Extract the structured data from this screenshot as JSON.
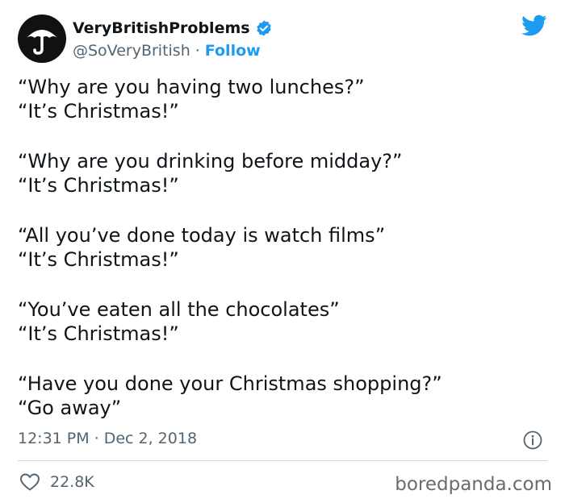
{
  "author": {
    "display_name": "VeryBritishProblems",
    "handle": "@SoVeryBritish",
    "separator": "·",
    "follow_label": "Follow",
    "avatar_icon": "umbrella-icon",
    "verified_icon": "verified-badge-icon"
  },
  "tweet": {
    "paragraphs": [
      {
        "line1": "“Why are you having two lunches?”",
        "line2": "“It’s Christmas!”"
      },
      {
        "line1": "“Why are you drinking before midday?”",
        "line2": "“It’s Christmas!”"
      },
      {
        "line1": "“All you’ve done today is watch films”",
        "line2": "“It’s Christmas!”"
      },
      {
        "line1": "“You’ve eaten all the chocolates”",
        "line2": "“It’s Christmas!”"
      },
      {
        "line1": "“Have you done your Christmas shopping?”",
        "line2": "“Go away”"
      }
    ],
    "time": "12:31 PM",
    "separator": "·",
    "date": "Dec 2, 2018"
  },
  "stats": {
    "likes": "22.8K"
  },
  "watermark": "boredpanda.com",
  "colors": {
    "accent": "#1d9bf0",
    "text": "#0f1419",
    "muted": "#536471"
  }
}
